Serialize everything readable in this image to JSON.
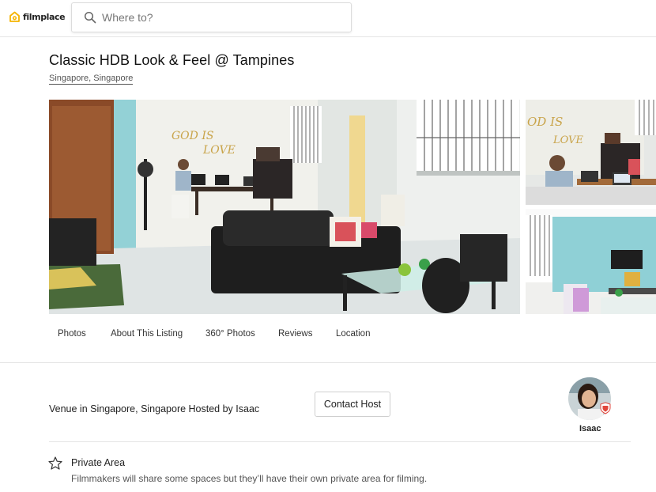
{
  "header": {
    "logo_text": "filmplace",
    "search_placeholder": "Where to?"
  },
  "listing": {
    "title": "Classic HDB Look & Feel @ Tampines",
    "location": "Singapore, Singapore",
    "photo_text": {
      "main_wall_line1": "GOD IS",
      "main_wall_line2": "LOVE",
      "side_wall_line1": "OD IS",
      "side_wall_line2": "LOVE"
    }
  },
  "tabs": [
    {
      "label": "Photos"
    },
    {
      "label": "About This Listing"
    },
    {
      "label": "360° Photos"
    },
    {
      "label": "Reviews"
    },
    {
      "label": "Location"
    }
  ],
  "host": {
    "summary": "Venue in Singapore, Singapore Hosted by Isaac",
    "contact_label": "Contact Host",
    "name": "Isaac"
  },
  "features": [
    {
      "icon": "star-icon",
      "title": "Private Area",
      "description": "Filmmakers will share some spaces but they’ll have their own private area for filming."
    }
  ],
  "colors": {
    "brand_yellow": "#f5b400",
    "text_primary": "#222222",
    "divider": "#e4e4e4",
    "wall_teal": "#8fd0d6",
    "badge_red": "#e0463b"
  }
}
